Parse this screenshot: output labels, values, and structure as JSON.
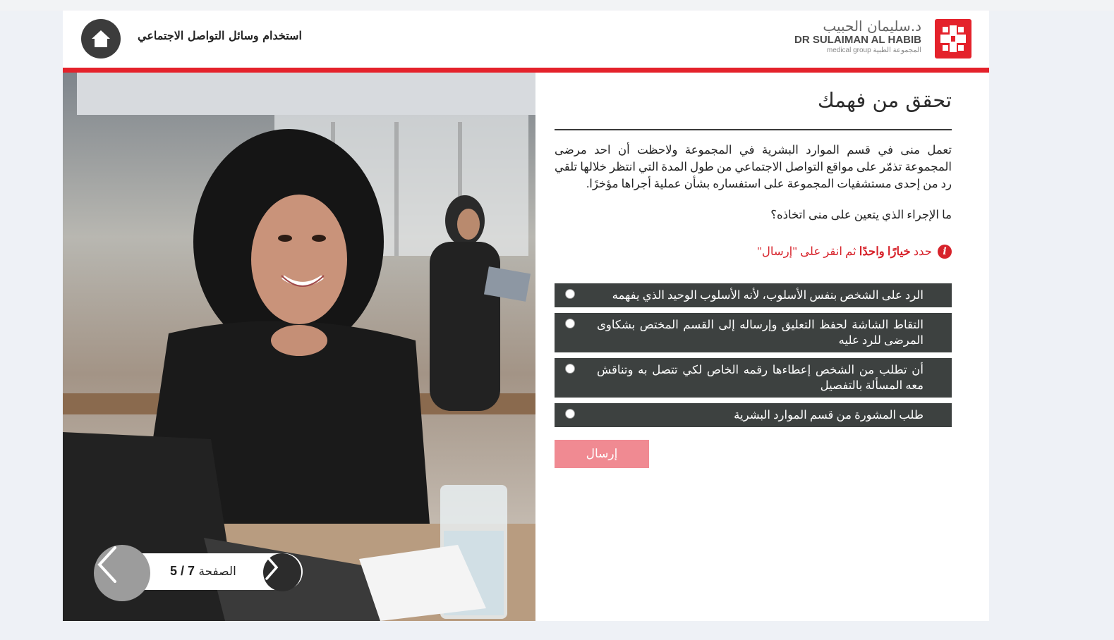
{
  "header": {
    "course_title": "استخدام وسائل التواصل الاجتماعي",
    "logo_arabic": "د.سليمان الحبيب",
    "logo_english": "DR SULAIMAN AL HABIB",
    "logo_sub": "medical group المجموعة الطبية"
  },
  "pager": {
    "label": "الصفحة",
    "current": "5",
    "separator": " / ",
    "total": "7"
  },
  "question": {
    "title": "تحقق من فهمك",
    "scenario": "تعمل منى في قسم الموارد البشرية في المجموعة ولاحظت أن احد مرضى المجموعة تذمّر على مواقع التواصل الاجتماعي من طول المدة التي انتظر خلالها تلقي رد من إحدى مستشفيات المجموعة على استفساره بشأن عملية أجراها مؤخرًا.",
    "prompt": "ما الإجراء الذي يتعين على منى اتخاذه؟",
    "instruction_pre": "حدد ",
    "instruction_bold": "خيارًا واحدًا",
    "instruction_post": " ثم انقر على \"إرسال\"",
    "options": [
      "الرد على الشخص بنفس الأسلوب، لأنه الأسلوب الوحيد الذي يفهمه",
      "التقاط الشاشة لحفظ التعليق وإرساله إلى القسم المختص بشكاوى المرضى للرد عليه",
      "أن تطلب من الشخص إعطاءها رقمه الخاص لكي تتصل به وتناقش معه المسألة بالتفصيل",
      "طلب المشورة من قسم الموارد البشرية"
    ],
    "submit_label": "إرسال"
  },
  "colors": {
    "brand_red": "#e4222b",
    "option_bg": "#3d4140",
    "submit_disabled": "#f08a92"
  }
}
